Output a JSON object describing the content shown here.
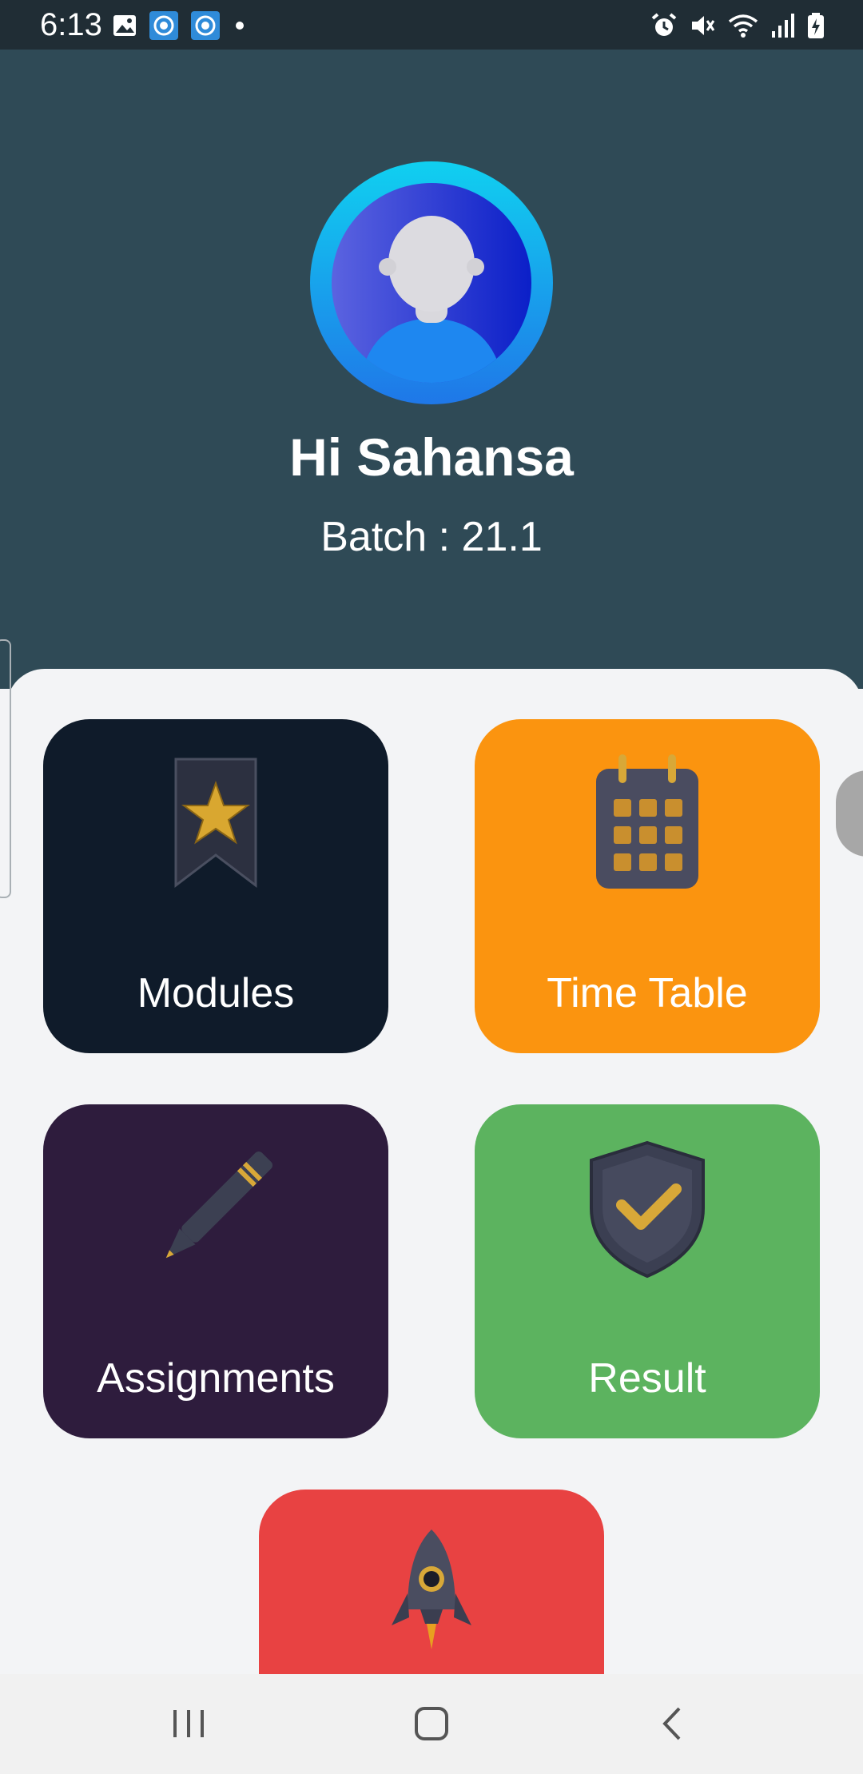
{
  "status_bar": {
    "time": "6:13",
    "left_icons": [
      "gallery-icon",
      "camera-app-icon",
      "camera-app-icon",
      "dot-icon"
    ],
    "right_icons": [
      "alarm-icon",
      "mute-icon",
      "wifi-icon",
      "signal-icon",
      "battery-charging-icon"
    ]
  },
  "profile": {
    "greeting": "Hi Sahansa",
    "batch": "Batch : 21.1"
  },
  "menu": {
    "modules": {
      "label": "Modules",
      "color": "#0f1b2a",
      "icon": "bookmark-star-icon"
    },
    "timetable": {
      "label": "Time Table",
      "color": "#fb940f",
      "icon": "calendar-icon"
    },
    "assignments": {
      "label": "Assignments",
      "color": "#2e1c3d",
      "icon": "pencil-icon"
    },
    "result": {
      "label": "Result",
      "color": "#5cb35f",
      "icon": "shield-check-icon"
    },
    "fifth": {
      "color": "#e84242",
      "icon": "rocket-icon"
    }
  },
  "colors": {
    "header_bg": "#2f4a56",
    "panel_bg": "#f3f4f6"
  },
  "nav": [
    "recent-apps-icon",
    "home-icon",
    "back-icon"
  ]
}
